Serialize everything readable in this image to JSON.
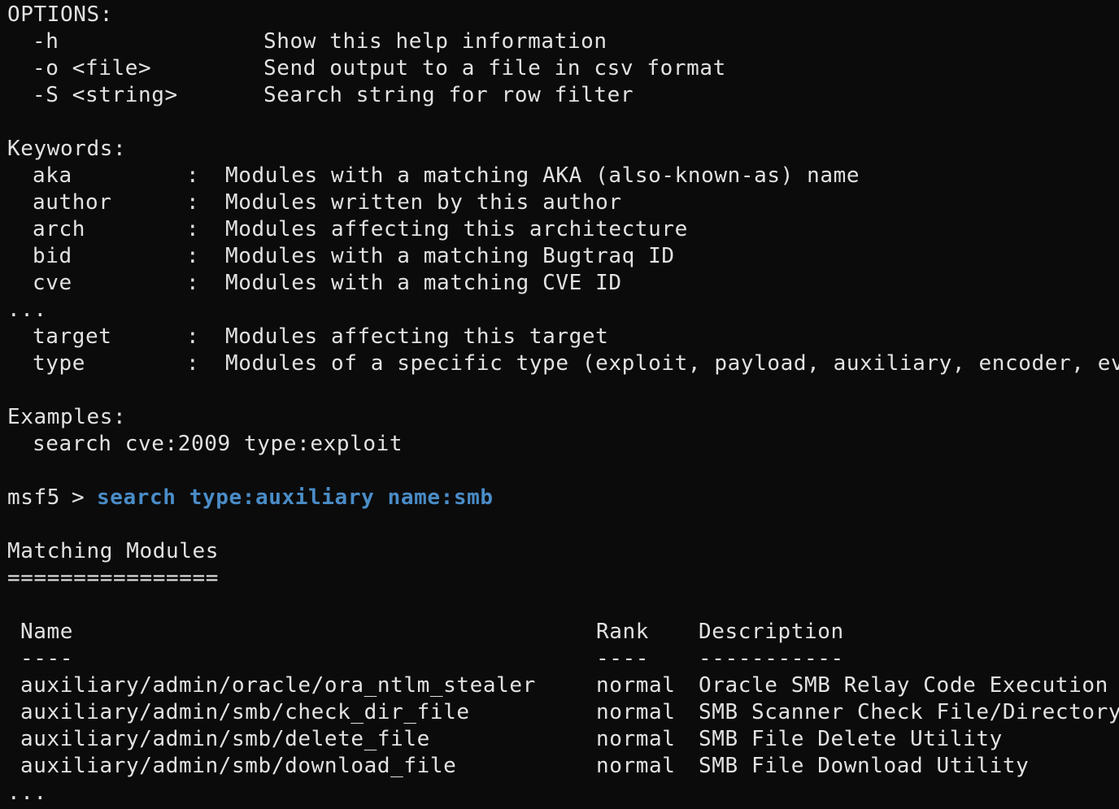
{
  "options": {
    "header": "OPTIONS:",
    "items": [
      {
        "flag": "-h",
        "desc": "Show this help information"
      },
      {
        "flag": "-o <file>",
        "desc": "Send output to a file in csv format"
      },
      {
        "flag": "-S <string>",
        "desc": "Search string for row filter"
      }
    ]
  },
  "keywords": {
    "header": "Keywords:",
    "separator": ":",
    "items": [
      {
        "key": "aka",
        "desc": "Modules with a matching AKA (also-known-as) name"
      },
      {
        "key": "author",
        "desc": "Modules written by this author"
      },
      {
        "key": "arch",
        "desc": "Modules affecting this architecture"
      },
      {
        "key": "bid",
        "desc": "Modules with a matching Bugtraq ID"
      },
      {
        "key": "cve",
        "desc": "Modules with a matching CVE ID"
      }
    ],
    "ellipsis": "...",
    "items_after": [
      {
        "key": "target",
        "desc": "Modules affecting this target"
      },
      {
        "key": "type",
        "desc": "Modules of a specific type (exploit, payload, auxiliary, encoder, eva"
      }
    ]
  },
  "examples": {
    "header": "Examples:",
    "example": "search cve:2009 type:exploit"
  },
  "prompt": {
    "label": "msf5",
    "symbol": ">",
    "command": "search type:auxiliary name:smb"
  },
  "results": {
    "title": "Matching Modules",
    "underline": "================",
    "columns": {
      "name": "Name",
      "rank": "Rank",
      "description": "Description"
    },
    "column_underlines": {
      "name": "----",
      "rank": "----",
      "description": "-----------"
    },
    "rows": [
      {
        "name": "auxiliary/admin/oracle/ora_ntlm_stealer",
        "rank": "normal",
        "description": "Oracle SMB Relay Code Execution"
      },
      {
        "name": "auxiliary/admin/smb/check_dir_file",
        "rank": "normal",
        "description": "SMB Scanner Check File/Directory"
      },
      {
        "name": "auxiliary/admin/smb/delete_file",
        "rank": "normal",
        "description": "SMB File Delete Utility"
      },
      {
        "name": "auxiliary/admin/smb/download_file",
        "rank": "normal",
        "description": "SMB File Download Utility"
      }
    ],
    "ellipsis": "..."
  },
  "colors": {
    "background": "#0b0b0b",
    "foreground": "#e2e2e2",
    "command": "#4a8cc7"
  }
}
